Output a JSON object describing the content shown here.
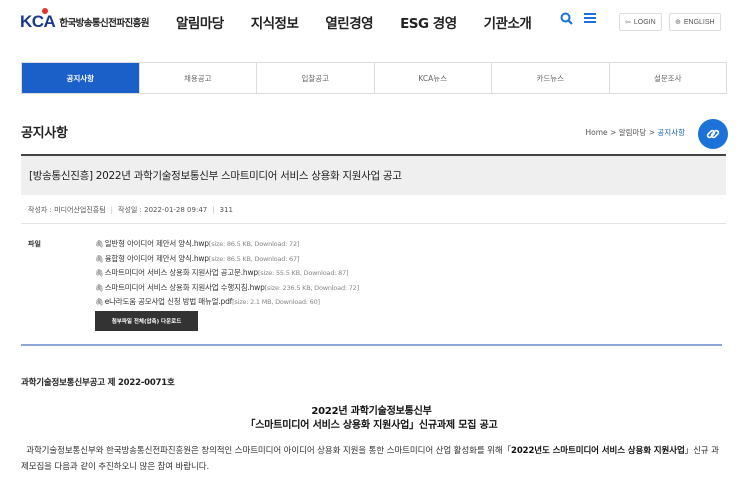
{
  "header": {
    "logo_mark": "KCA",
    "logo_text": "한국방송통신전파진흥원",
    "nav": [
      "알림마당",
      "지식정보",
      "열린경영",
      "ESG 경영",
      "기관소개"
    ],
    "login_label": "LOGIN",
    "english_label": "ENGLISH"
  },
  "tabs": [
    "공지사항",
    "채용공고",
    "입찰공고",
    "KCA뉴스",
    "카드뉴스",
    "설문조사"
  ],
  "page": {
    "title": "공지사항",
    "breadcrumb": {
      "home": "Home",
      "sep": ">",
      "parent": "알림마당",
      "current": "공지사항"
    }
  },
  "article": {
    "title": "[방송통신진흥] 2022년 과학기술정보통신부 스마트미디어 서비스 상용화 지원사업 공고",
    "author_label": "작성자 : 미디어산업진흥팀",
    "date_label": "작성일 : 2022-01-28 09:47",
    "views": "311",
    "files_label": "파일",
    "files": [
      {
        "name": "일반형 아이디어 제안서 양식.hwp",
        "info": "[size: 86.5 KB, Download: 72]"
      },
      {
        "name": "융합형 아이디어 제안서 양식.hwp",
        "info": "[size: 86.5 KB, Download: 67]"
      },
      {
        "name": "스마트미디어 서비스 상용화 지원사업 공고문.hwp",
        "info": "[size: 55.5 KB, Download: 87]"
      },
      {
        "name": "스마트미디어 서비스 상용화 지원사업 수행지침.hwp",
        "info": "[size: 236.5 KB, Download: 72]"
      },
      {
        "name": "e나라도움 공모사업 신청 방법 매뉴얼.pdf",
        "info": "[size: 2.1 MB, Download: 60]"
      }
    ],
    "download_all_label": "첨부파일 전체(압축) 다운로드"
  },
  "content": {
    "notice_no": "과학기술정보통신부공고 제 2022-0071호",
    "heading_line1": "2022년 과학기술정보통신부",
    "heading_line2": "「스마트미디어 서비스 상용화 지원사업」신규과제 모집 공고",
    "para_a": "과학기술정보통신부와 한국방송통신전파진흥원은 창의적인 스마트미디어 아이디어 상용화 지원을 통한 스마트미디어 산업 활성화를 위해「",
    "para_b": "2022년도 스마트미디어 서비스 상용화 지원사업",
    "para_c": "」신규 과제모집을 다음과 같이 추진하오니 많은 참여 바랍니다."
  }
}
